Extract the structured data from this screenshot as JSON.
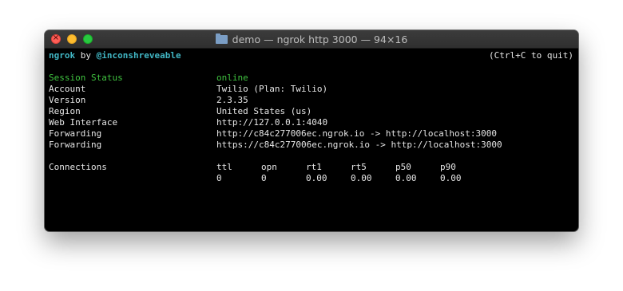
{
  "window": {
    "title": "demo — ngrok http 3000 — 94×16",
    "close_glyph": "×"
  },
  "terminal": {
    "brand": "ngrok",
    "by": " by ",
    "author": "@inconshreveable",
    "quit_hint": "(Ctrl+C to quit)",
    "rows": [
      {
        "label": "Session Status",
        "value": "online"
      },
      {
        "label": "Account",
        "value": "Twilio (Plan: Twilio)"
      },
      {
        "label": "Version",
        "value": "2.3.35"
      },
      {
        "label": "Region",
        "value": "United States (us)"
      },
      {
        "label": "Web Interface",
        "value": "http://127.0.0.1:4040"
      },
      {
        "label": "Forwarding",
        "value": "http://c84c277006ec.ngrok.io -> http://localhost:3000"
      },
      {
        "label": "Forwarding",
        "value": "https://c84c277006ec.ngrok.io -> http://localhost:3000"
      }
    ],
    "connections": {
      "label": "Connections",
      "headers": [
        "ttl",
        "opn",
        "rt1",
        "rt5",
        "p50",
        "p90"
      ],
      "values": [
        "0",
        "0",
        "0.00",
        "0.00",
        "0.00",
        "0.00"
      ]
    }
  }
}
